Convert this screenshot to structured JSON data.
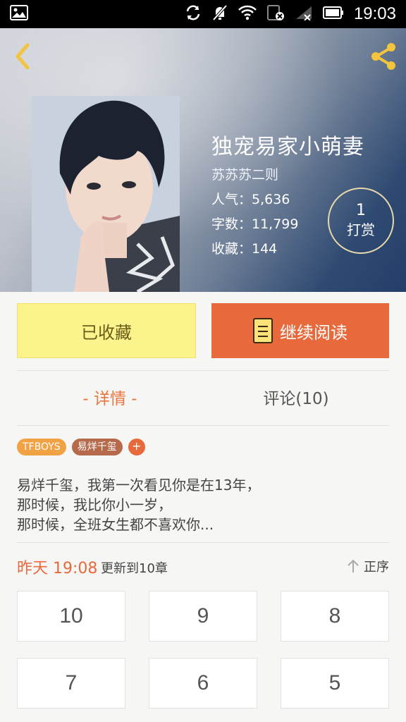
{
  "status_bar": {
    "time": "19:03",
    "icons": [
      "image-icon",
      "sync-icon",
      "mute-icon",
      "wifi-icon",
      "sim-icon",
      "signal-icon",
      "battery-icon"
    ]
  },
  "book": {
    "title": "独宠易家小萌妻",
    "author": "苏苏苏二则",
    "popularity": "人气：5,636",
    "word_count": "字数：11,799",
    "favorites": "收藏：144",
    "reward_count": "1",
    "reward_label": "打赏"
  },
  "actions": {
    "collected_label": "已收藏",
    "continue_label": "继续阅读"
  },
  "tabs": {
    "detail": "- 详情 -",
    "comments": "评论(10)"
  },
  "tags": [
    "TFBOYS",
    "易烊千玺"
  ],
  "tag_add": "+",
  "description": [
    "易烊千玺，我第一次看见你是在13年，",
    "那时候，我比你小一岁，",
    "那时候，全班女生都不喜欢你..."
  ],
  "update": {
    "time": "昨天 19:08",
    "text": "更新到10章",
    "sort_label": "正序"
  },
  "chapters": [
    "10",
    "9",
    "8",
    "7",
    "6",
    "5"
  ],
  "colors": {
    "accent": "#e8693b",
    "collected_bg": "#fdf38c",
    "tag_primary": "#f0a244",
    "tag_secondary": "#b56b4b"
  }
}
